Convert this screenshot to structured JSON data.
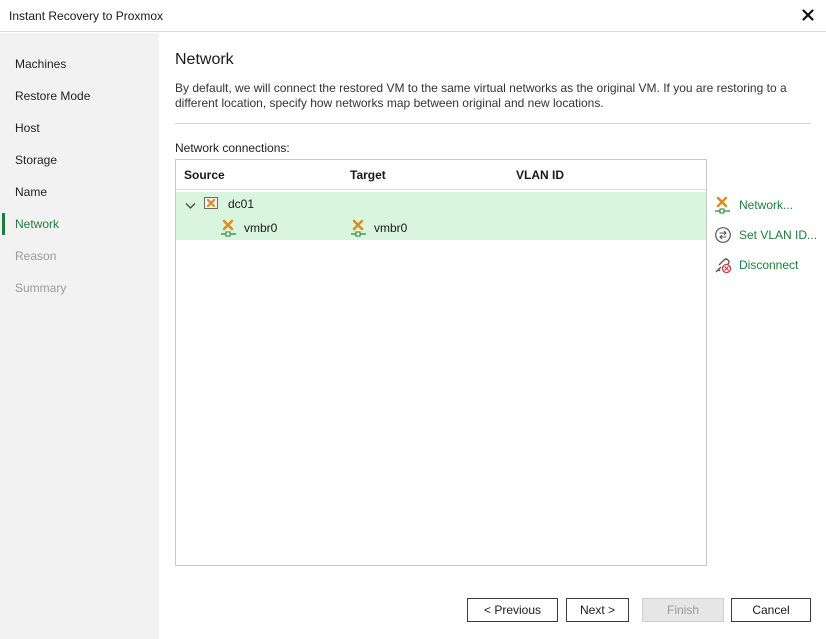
{
  "window": {
    "title": "Instant Recovery to Proxmox",
    "close_icon": "close-icon"
  },
  "sidebar": {
    "items": [
      {
        "label": "Machines",
        "state": "normal"
      },
      {
        "label": "Restore Mode",
        "state": "normal"
      },
      {
        "label": "Host",
        "state": "normal"
      },
      {
        "label": "Storage",
        "state": "normal"
      },
      {
        "label": "Name",
        "state": "normal"
      },
      {
        "label": "Network",
        "state": "active"
      },
      {
        "label": "Reason",
        "state": "disabled"
      },
      {
        "label": "Summary",
        "state": "disabled"
      }
    ]
  },
  "main": {
    "title": "Network",
    "description": "By default, we will connect the restored VM to the same virtual networks as the original VM. If you are restoring to a different location, specify how networks map between original and new locations.",
    "connections_label": "Network connections:",
    "table": {
      "columns": [
        "Source",
        "Target",
        "VLAN ID"
      ],
      "vm": {
        "name": "dc01",
        "icon": "vm-icon",
        "expander_icon": "chevron-down-icon"
      },
      "mapping": {
        "source": "vmbr0",
        "target": "vmbr0",
        "vlan": "",
        "icon": "network-icon"
      }
    }
  },
  "actions": [
    {
      "label": "Network...",
      "icon": "network-icon"
    },
    {
      "label": "Set VLAN ID...",
      "icon": "vlan-icon"
    },
    {
      "label": "Disconnect",
      "icon": "disconnect-icon"
    }
  ],
  "buttons": {
    "previous": "< Previous",
    "next": "Next >",
    "finish": "Finish",
    "cancel": "Cancel"
  },
  "colors": {
    "accent": "#1e7d3c",
    "selection": "#daf5de",
    "sidebar_bg": "#f2f2f2",
    "disabled_text": "#9a9a9a"
  }
}
